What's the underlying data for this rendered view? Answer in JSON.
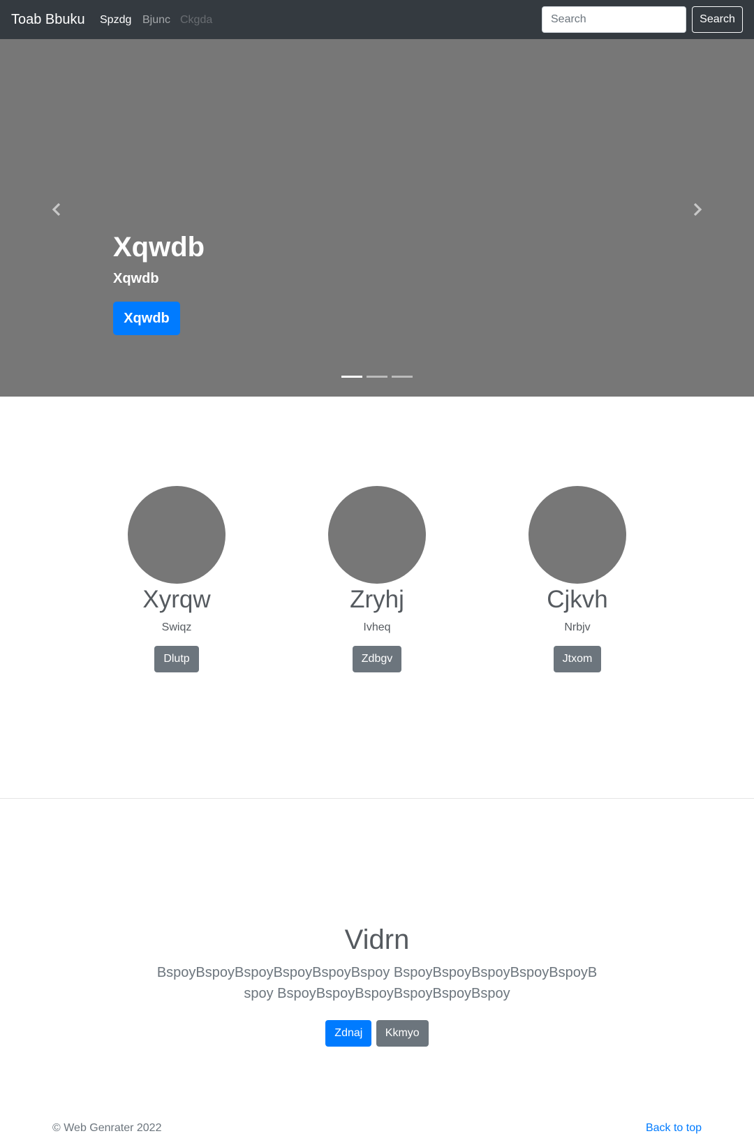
{
  "navbar": {
    "brand": "Toab Bbuku",
    "links": [
      "Spzdg",
      "Bjunc",
      "Ckgda"
    ],
    "search": {
      "placeholder": "Search",
      "button_label": "Search"
    }
  },
  "carousel": {
    "title": "Xqwdb",
    "text": "Xqwdb",
    "button_label": "Xqwdb",
    "slide_count": 3,
    "active_slide": 1
  },
  "features": [
    {
      "title": "Xyrqw",
      "text": "Swiqz",
      "button_label": "Dlutp"
    },
    {
      "title": "Zryhj",
      "text": "Ivheq",
      "button_label": "Zdbgv"
    },
    {
      "title": "Cjkvh",
      "text": "Nrbjv",
      "button_label": "Jtxom"
    }
  ],
  "jumbotron": {
    "title": "Vidrn",
    "text": "BspoyBspoyBspoyBspoyBspoyBspoy BspoyBspoyBspoyBspoyBspoyBspoy BspoyBspoyBspoyBspoyBspoyBspoy",
    "primary_label": "Zdnaj",
    "secondary_label": "Kkmyo"
  },
  "footer": {
    "copyright": "© Web Genrater 2022",
    "back_to_top": "Back to top"
  },
  "colors": {
    "navbar_bg": "#343a40",
    "carousel_bg": "#777777",
    "primary": "#007bff",
    "secondary": "#6c757d"
  },
  "icons": {
    "carousel_prev": "chevron-left-icon",
    "carousel_next": "chevron-right-icon"
  }
}
